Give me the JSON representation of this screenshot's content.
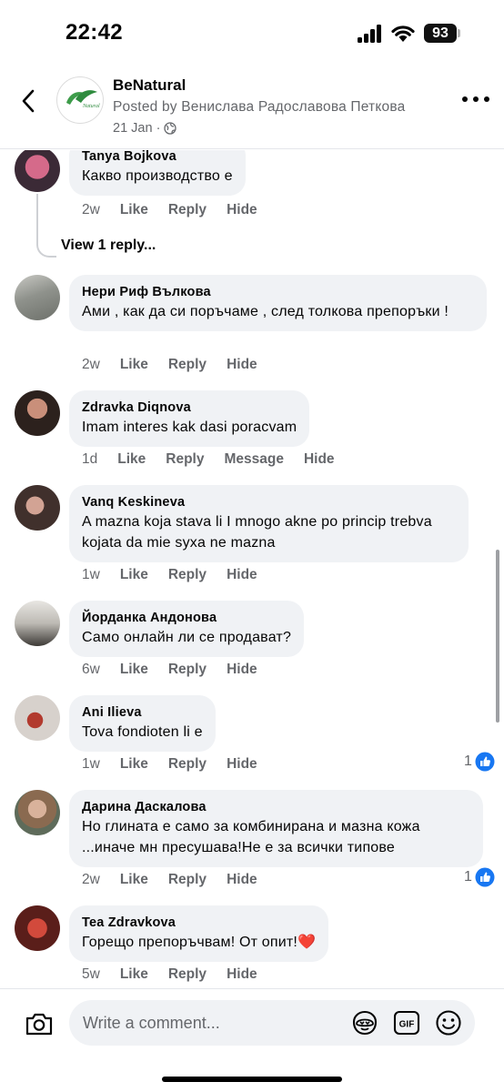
{
  "status_bar": {
    "time": "22:42",
    "battery": "93"
  },
  "header": {
    "page_name": "BeNatural",
    "posted_by": "Posted by Венислава Радославова Петкова",
    "date": "21 Jan ·",
    "logo_text": "Natural",
    "icons": {
      "back": "chevron-left-icon",
      "more": "more-horizontal-icon",
      "audience": "globe-icon"
    }
  },
  "comments": [
    {
      "author": "Tanya Bojkova",
      "text": "Какво производство  е",
      "time": "2w",
      "like": "Like",
      "reply": "Reply",
      "hide": "Hide",
      "view_replies": "View 1 reply..."
    },
    {
      "author": "Нери Риф Вълкова",
      "text": "Ами , как да си поръчаме , след толкова препоръки !",
      "time": "2w",
      "like": "Like",
      "reply": "Reply",
      "hide": "Hide"
    },
    {
      "author": "Zdravka Diqnova",
      "text": "Imam interes kak dasi poracvam",
      "time": "1d",
      "like": "Like",
      "reply": "Reply",
      "message": "Message",
      "hide": "Hide"
    },
    {
      "author": "Vanq Keskineva",
      "text": "A mazna koja stava li I mnogo akne po princip trebva kojata da mie syxa ne mazna",
      "time": "1w",
      "like": "Like",
      "reply": "Reply",
      "hide": "Hide"
    },
    {
      "author": "Йорданка Андонова",
      "text": "Само онлайн ли се продават?",
      "time": "6w",
      "like": "Like",
      "reply": "Reply",
      "hide": "Hide"
    },
    {
      "author": "Ani Ilieva",
      "text": "Tova fondioten li e",
      "time": "1w",
      "like": "Like",
      "reply": "Reply",
      "hide": "Hide",
      "reactions": "1"
    },
    {
      "author": "Дарина Даскалова",
      "text": "Но глината е само за комбинирана и мазна кожа ...иначе мн пресушава!Не е за всички типове",
      "time": "2w",
      "like": "Like",
      "reply": "Reply",
      "hide": "Hide",
      "reactions": "1"
    },
    {
      "author": "Tea Zdravkova",
      "text": "Горещо препоръчвам! От опит!❤️",
      "time": "5w",
      "like": "Like",
      "reply": "Reply",
      "hide": "Hide"
    }
  ],
  "composer": {
    "placeholder": "Write a comment...",
    "icons": [
      "camera-icon",
      "avatar-sticker-icon",
      "gif-icon",
      "emoji-icon"
    ]
  },
  "colors": {
    "accent": "#1877f2",
    "bubble": "#f0f2f5",
    "secondary_text": "#65676b",
    "heart": "#e0245e"
  }
}
